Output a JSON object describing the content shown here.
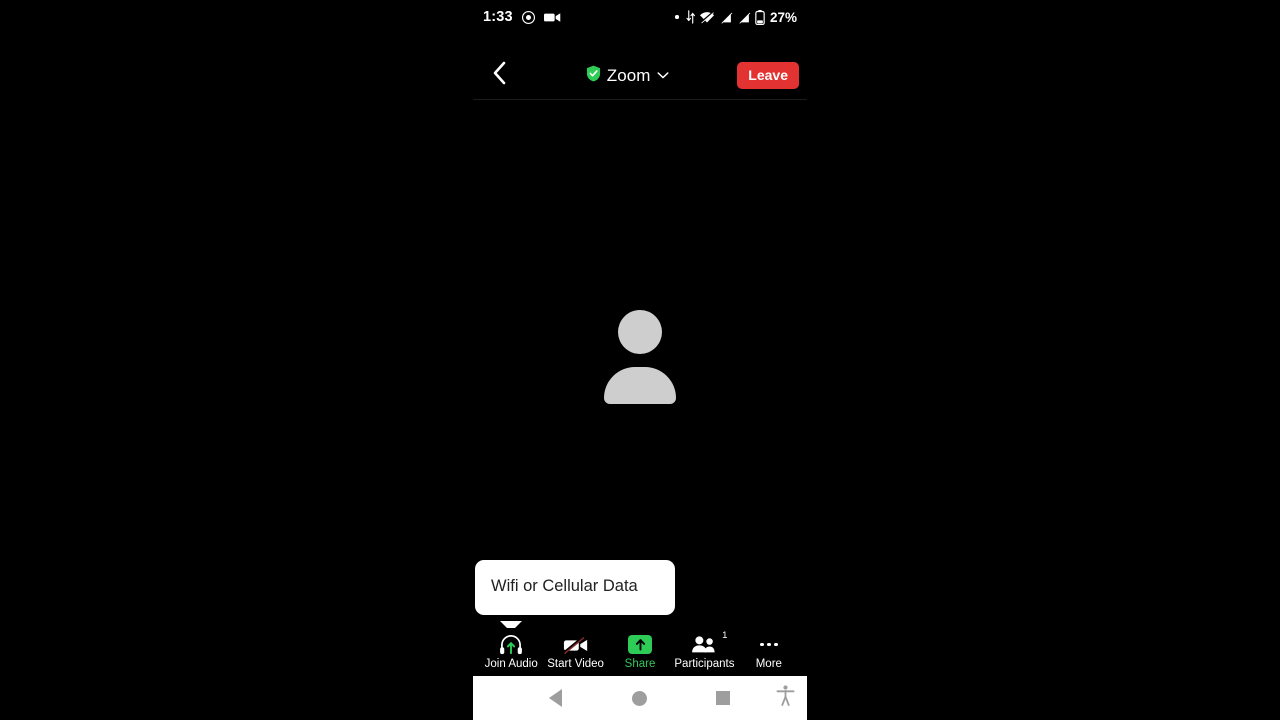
{
  "status_bar": {
    "time": "1:33",
    "battery_percent": "27%",
    "icons": [
      "screen-record-icon",
      "camera-icon",
      "notification-dot-icon",
      "vpn-arrows-icon",
      "wifi-off-icon",
      "signal-sim1-off-icon",
      "signal-sim2-off-icon",
      "battery-icon"
    ]
  },
  "header": {
    "back_icon": "chevron-left-icon",
    "shield_icon": "shield-check-icon",
    "title": "Zoom",
    "dropdown_icon": "chevron-down-icon",
    "leave_label": "Leave",
    "leave_color": "#E33232",
    "shield_color": "#2ECC57"
  },
  "stage": {
    "avatar_icon": "default-user-avatar",
    "avatar_color": "#cecece"
  },
  "tooltip": {
    "text": "Wifi or Cellular Data",
    "background": "#ffffff",
    "text_color": "#222222"
  },
  "toolbar": {
    "items": [
      {
        "label": "Join Audio",
        "icon": "headphones-join-audio-icon",
        "accent": false
      },
      {
        "label": "Start Video",
        "icon": "video-off-icon",
        "accent": false
      },
      {
        "label": "Share",
        "icon": "share-screen-icon",
        "accent": true
      },
      {
        "label": "Participants",
        "icon": "participants-icon",
        "accent": false,
        "badge": "1"
      },
      {
        "label": "More",
        "icon": "more-dots-icon",
        "accent": false
      }
    ],
    "accent_color": "#35C759"
  },
  "navbar": {
    "background": "#ffffff",
    "items": [
      {
        "label": "Back",
        "icon": "nav-back-triangle-icon"
      },
      {
        "label": "Home",
        "icon": "nav-home-circle-icon"
      },
      {
        "label": "Recents",
        "icon": "nav-recents-square-icon"
      },
      {
        "label": "Accessibility",
        "icon": "accessibility-person-icon"
      }
    ]
  }
}
